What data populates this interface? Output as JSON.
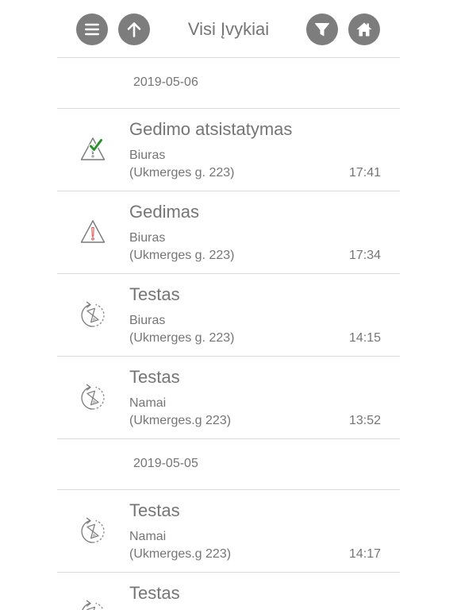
{
  "header": {
    "title": "Visi Įvykiai",
    "buttons": [
      "menu-icon",
      "arrow-up-icon",
      "filter-icon",
      "home-icon"
    ]
  },
  "colors": {
    "button_bg": "#7d7d7d",
    "text": "#757575",
    "divider": "#d9d9d9",
    "check_green": "#2f8f2f",
    "alert_red": "#d9534f"
  },
  "groups": [
    {
      "date": "2019-05-06",
      "events": [
        {
          "title": "Gedimo atsistatymas",
          "location": "Biuras",
          "address": "(Ukmerges g. 223)",
          "time": "17:41",
          "icon": "fault-restored-icon"
        },
        {
          "title": "Gedimas",
          "location": "Biuras",
          "address": "(Ukmerges g. 223)",
          "time": "17:34",
          "icon": "fault-icon"
        },
        {
          "title": "Testas",
          "location": "Biuras",
          "address": "(Ukmerges g. 223)",
          "time": "14:15",
          "icon": "test-icon"
        },
        {
          "title": "Testas",
          "location": "Namai",
          "address": "(Ukmerges.g 223)",
          "time": "13:52",
          "icon": "test-icon"
        }
      ]
    },
    {
      "date": "2019-05-05",
      "events": [
        {
          "title": "Testas",
          "location": "Namai",
          "address": "(Ukmerges.g 223)",
          "time": "14:17",
          "icon": "test-icon"
        },
        {
          "title": "Testas",
          "icon": "test-icon"
        }
      ]
    }
  ]
}
